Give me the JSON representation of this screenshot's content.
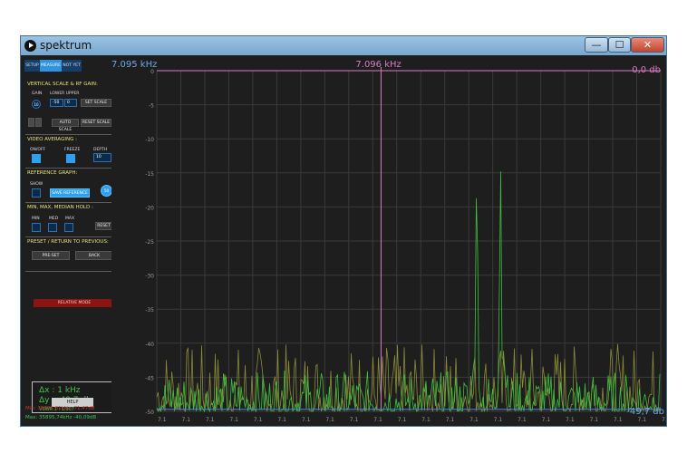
{
  "window": {
    "title": "spektrum",
    "controls": {
      "minimize": "—",
      "maximize": "☐",
      "close": "✕"
    },
    "colors": {
      "title_bar": "#8db8de",
      "client_bg": "#1e1e1e",
      "close": "#c9483a"
    }
  },
  "tabs": [
    {
      "label": "SETUP",
      "active": false
    },
    {
      "label": "MEASURE",
      "active": true
    },
    {
      "label": "NOT YET",
      "active": false
    }
  ],
  "vertical_scale": {
    "heading": "VERTICAL SCALE & RF GAIN:",
    "gain_label": "GAIN",
    "gain_value": "10",
    "lower_upper_label": "LOWER UPPER",
    "lower_value": "-50",
    "upper_value": "0",
    "set_scale": "SET SCALE",
    "auto_scale": "AUTO SCALE",
    "reset_scale": "RESET SCALE"
  },
  "video_averaging": {
    "heading": "VIDEO AVERAGING :",
    "onoff_label": "ON/OFF",
    "freeze_label": "FREEZE",
    "depth_label": "DEPTH",
    "depth_value": "10"
  },
  "reference_graph": {
    "heading": "REFERENCE GRAPH:",
    "show_label": "SHOW",
    "save_reference": "SAVE REFERENCE",
    "knob_value": "50"
  },
  "hold": {
    "heading": "MIN, MAX, MEDIAN HOLD :",
    "min_label": "MIN",
    "med_label": "MED",
    "max_label": "MAX",
    "reset": "RESET"
  },
  "preset": {
    "heading": "PRESET / RETURN TO PREVIOUS:",
    "preset_button": "PRE-SET",
    "back_button": "BACK"
  },
  "relative_mode": "RELATIVE MODE",
  "delta": {
    "dx": "Δx : 1 kHz",
    "dy": "Δy : -49,7 db",
    "vswr": "VSWR 1 : 1,007"
  },
  "help": "HELP",
  "readouts": {
    "min": "Min: 35895,31kHz -71,47dB",
    "max": "Max: 35895,74kHz -40,09dB"
  },
  "markers": {
    "left_freq": "7.095 kHz",
    "center_freq": "7.096 kHz",
    "top_db": "0,0 db",
    "bottom_db": "-49,7 db"
  },
  "chart_data": {
    "type": "line",
    "title": "",
    "xlabel": "",
    "ylabel": "",
    "ylim": [
      -50,
      0
    ],
    "yticks": [
      "0",
      "-5",
      "-10",
      "-15",
      "-20",
      "-25",
      "-30",
      "-35",
      "-40",
      "-45",
      "-50"
    ],
    "xticks": [
      "7.1",
      "7.1",
      "7.1",
      "7.1",
      "7.1",
      "7.1",
      "7.1",
      "7.1",
      "7.1",
      "7.1",
      "7.1",
      "7.1",
      "7.1",
      "7.1",
      "7.1",
      "7.1",
      "7.1",
      "7.1",
      "7.1",
      "7.1",
      "7.1",
      "7.1"
    ],
    "grid": true,
    "series": [
      {
        "color": "#3fbf3f",
        "peaks_db": [
          -42,
          -13.2,
          -42,
          -13,
          -42
        ],
        "noise_floor_db": [
          -50,
          -44
        ]
      },
      {
        "color": "#8a8a3a",
        "noise_floor_db": [
          -50,
          -40
        ]
      }
    ],
    "colors": {
      "marker": "#d97bc4",
      "axis_text": "#6fa8e6",
      "grid": "#3a3a3a",
      "ref_line": "#4a88d8"
    }
  }
}
